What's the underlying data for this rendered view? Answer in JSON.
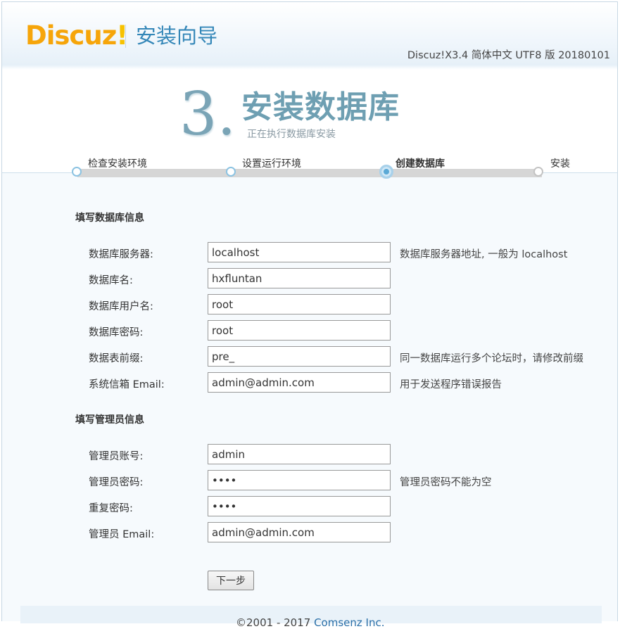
{
  "header": {
    "logo_part1": "Discuz",
    "logo_part2": "!",
    "title": "安装向导",
    "version": "Discuz!X3.4 简体中文 UTF8 版 20180101"
  },
  "step": {
    "number": "3.",
    "title": "安装数据库",
    "subtitle": "正在执行数据库安装"
  },
  "progress": {
    "steps": [
      {
        "label": "检查安装环境",
        "state": "done"
      },
      {
        "label": "设置运行环境",
        "state": "done"
      },
      {
        "label": "创建数据库",
        "state": "current"
      },
      {
        "label": "安装",
        "state": "todo"
      }
    ]
  },
  "db_section": {
    "title": "填写数据库信息",
    "rows": [
      {
        "label": "数据库服务器:",
        "value": "localhost",
        "hint": "数据库服务器地址, 一般为 localhost"
      },
      {
        "label": "数据库名:",
        "value": "hxfluntan",
        "hint": ""
      },
      {
        "label": "数据库用户名:",
        "value": "root",
        "hint": ""
      },
      {
        "label": "数据库密码:",
        "value": "root",
        "hint": ""
      },
      {
        "label": "数据表前缀:",
        "value": "pre_",
        "hint": "同一数据库运行多个论坛时，请修改前缀"
      },
      {
        "label": "系统信箱 Email:",
        "value": "admin@admin.com",
        "hint": "用于发送程序错误报告"
      }
    ]
  },
  "admin_section": {
    "title": "填写管理员信息",
    "rows": [
      {
        "label": "管理员账号:",
        "value": "admin",
        "hint": ""
      },
      {
        "label": "管理员密码:",
        "value": "••••",
        "hint": "管理员密码不能为空"
      },
      {
        "label": "重复密码:",
        "value": "••••",
        "hint": ""
      },
      {
        "label": "管理员 Email:",
        "value": "admin@admin.com",
        "hint": ""
      }
    ]
  },
  "next_button": "下一步",
  "footer": {
    "copyright": "©2001 - 2017 ",
    "company": "Comsenz Inc."
  }
}
